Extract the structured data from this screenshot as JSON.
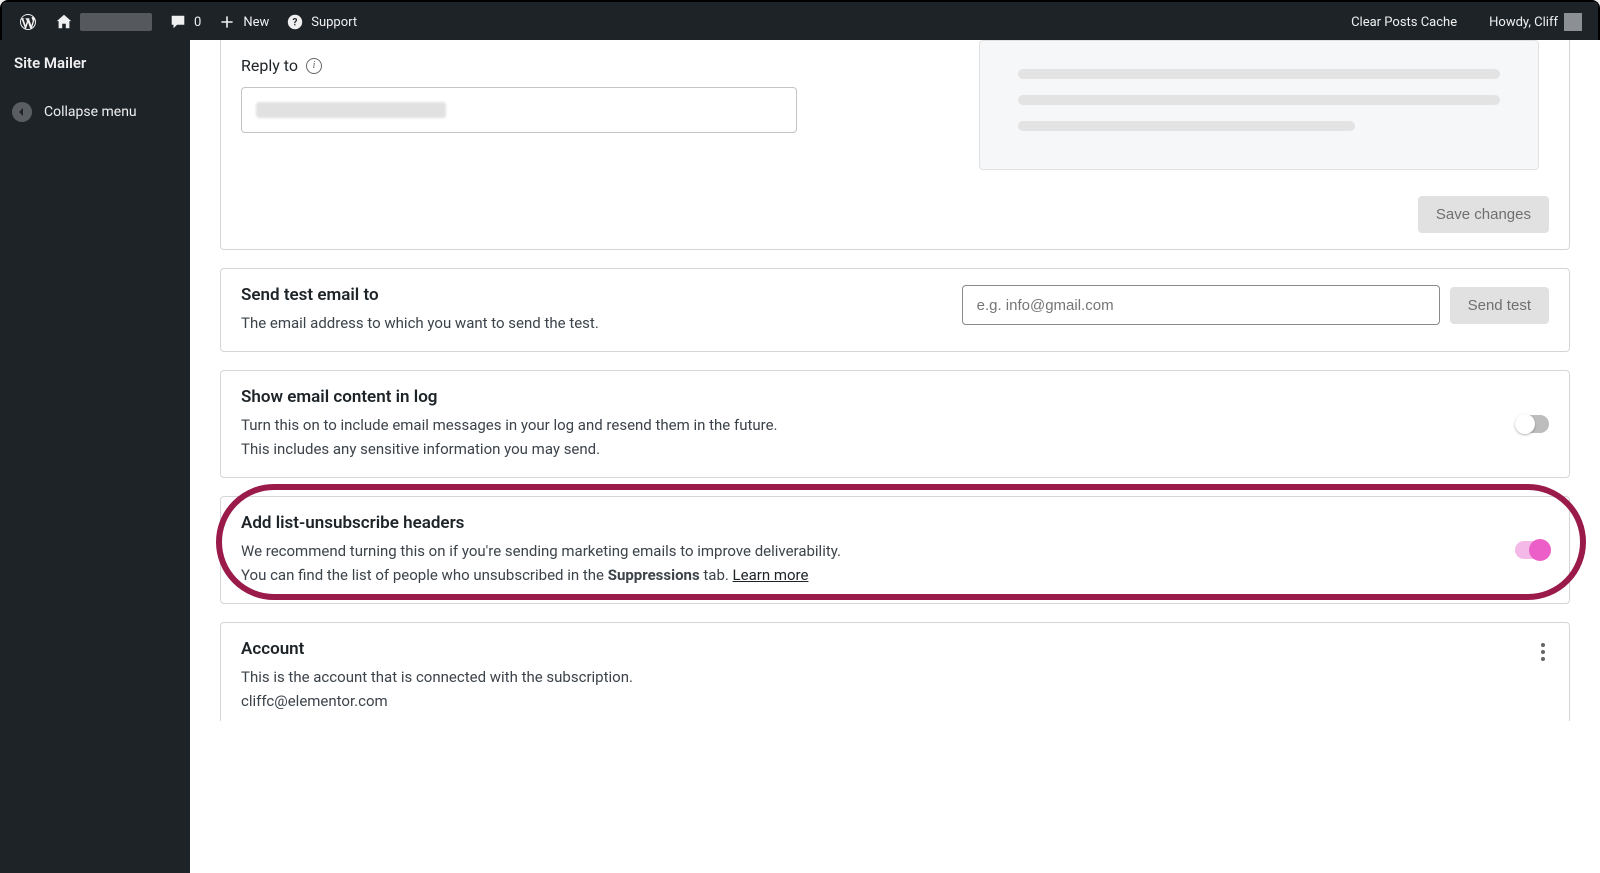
{
  "adminbar": {
    "comments_count": "0",
    "new_label": "New",
    "support_label": "Support",
    "clear_cache_label": "Clear Posts Cache",
    "howdy_label": "Howdy, Cliff"
  },
  "sidebar": {
    "site_mailer_label": "Site Mailer",
    "collapse_label": "Collapse menu"
  },
  "replyto": {
    "label": "Reply to"
  },
  "save_button": "Save changes",
  "test": {
    "title": "Send test email to",
    "desc": "The email address to which you want to send the test.",
    "placeholder": "e.g. info@gmail.com",
    "button": "Send test"
  },
  "log": {
    "title": "Show email content in log",
    "desc1": "Turn this on to include email messages in your log and resend them in the future.",
    "desc2": "This includes any sensitive information you may send."
  },
  "unsub": {
    "title": "Add list-unsubscribe headers",
    "desc_pre": "We recommend turning this on if you're sending marketing emails to improve deliverability. You can find the list of people who unsubscribed in the ",
    "bold": "Suppressions",
    "desc_post": " tab. ",
    "learn_more": "Learn more"
  },
  "account": {
    "title": "Account",
    "desc": "This is the account that is connected with the subscription.",
    "email": "cliffc@elementor.com"
  }
}
